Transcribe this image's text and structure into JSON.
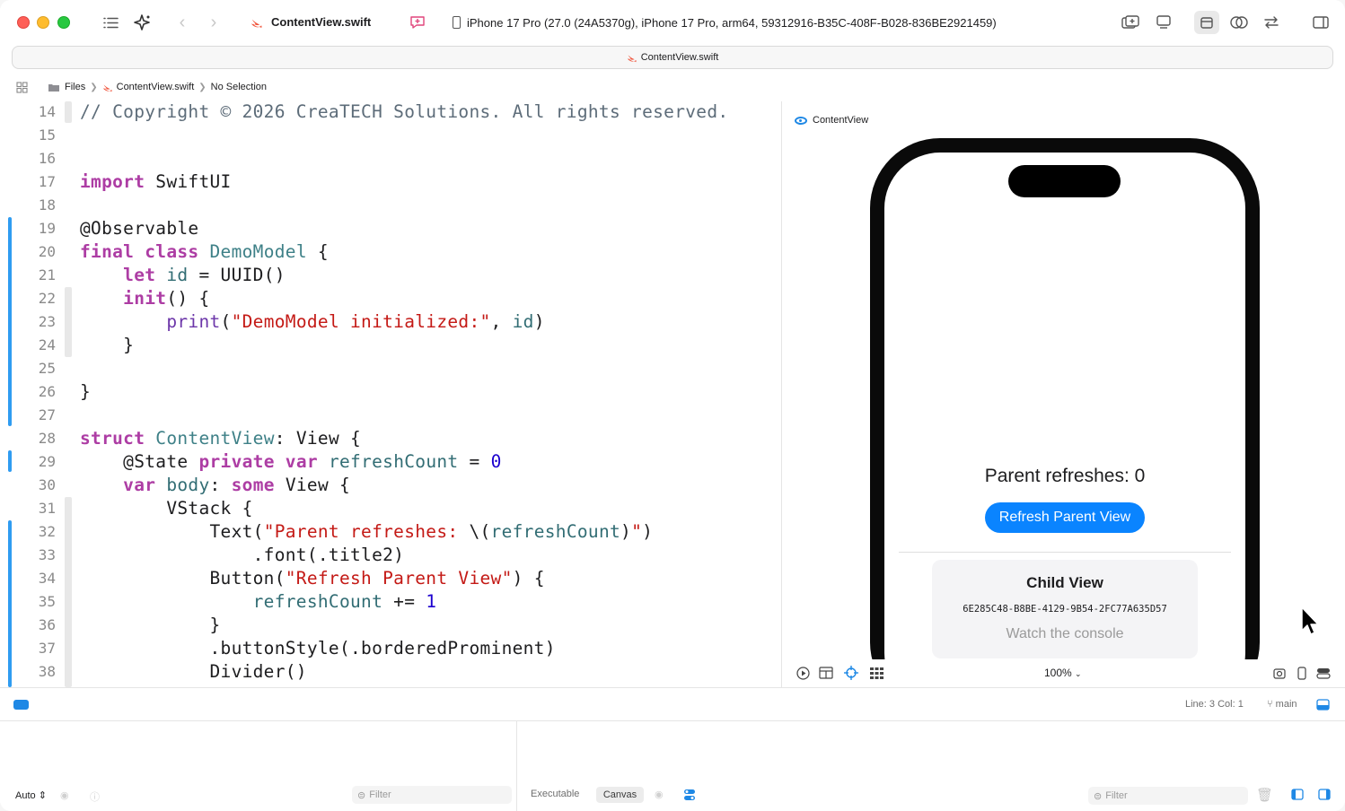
{
  "toolbar": {
    "file_tab": "ContentView.swift",
    "destination": "iPhone 17 Pro (27.0 (24A5370g), iPhone 17 Pro, arm64, 59312916-B35C-408F-B028-836BE2921459)",
    "icons": [
      "sidebar-list-icon",
      "sparkle-icon",
      "back-chevron-icon",
      "forward-chevron-icon",
      "comment-plus-icon",
      "library-icon",
      "device-icon",
      "inspector-icon",
      "review-icon",
      "swap-icon",
      "right-sidebar-icon"
    ]
  },
  "tabbar": {
    "title": "ContentView.swift"
  },
  "jumpbar": {
    "files": "Files",
    "file": "ContentView.swift",
    "selection": "No Selection"
  },
  "editor": {
    "lines": [
      {
        "n": "14"
      },
      {
        "n": "15"
      },
      {
        "n": "16"
      },
      {
        "n": "17"
      },
      {
        "n": "18"
      },
      {
        "n": "19"
      },
      {
        "n": "20"
      },
      {
        "n": "21"
      },
      {
        "n": "22"
      },
      {
        "n": "23"
      },
      {
        "n": "24"
      },
      {
        "n": "25"
      },
      {
        "n": "26"
      },
      {
        "n": "27"
      },
      {
        "n": "28"
      },
      {
        "n": "29"
      },
      {
        "n": "30"
      },
      {
        "n": "31"
      },
      {
        "n": "32"
      },
      {
        "n": "33"
      },
      {
        "n": "34"
      },
      {
        "n": "35"
      },
      {
        "n": "36"
      },
      {
        "n": "37"
      },
      {
        "n": "38"
      }
    ],
    "tokens": {
      "l14": "// Copyright © 2026 CreaTECH Solutions. All rights reserved.",
      "l17_kw": "import",
      "l17_rest": " SwiftUI",
      "l19": "@Observable",
      "l20_kw": "final class",
      "l20_ty": "DemoModel",
      "l20_rest": " {",
      "l21_kw": "let",
      "l21_id": "id",
      "l21_rest": " = UUID()",
      "l22_kw": "init",
      "l22_rest": "() {",
      "l23_fn": "print",
      "l23_p1": "(",
      "l23_str": "\"DemoModel initialized:\"",
      "l23_p2": ", ",
      "l23_id": "id",
      "l23_p3": ")",
      "l24": "}",
      "l26": "}",
      "l28_kw": "struct",
      "l28_ty": "ContentView",
      "l28_rest": ": View {",
      "l29_attr": "@State",
      "l29_kw": "private var",
      "l29_id": "refreshCount",
      "l29_eq": " = ",
      "l29_num": "0",
      "l30_kw": "var",
      "l30_id": "body",
      "l30_p": ": ",
      "l30_kw2": "some",
      "l30_rest": " View {",
      "l31": "VStack {",
      "l32_a": "Text(",
      "l32_str1": "\"Parent refreshes: ",
      "l32_b": "\\(",
      "l32_id": "refreshCount",
      "l32_c": ")",
      "l32_str2": "\"",
      "l32_d": ")",
      "l33": ".font(.title2)",
      "l34_a": "Button(",
      "l34_str": "\"Refresh Parent View\"",
      "l34_b": ") {",
      "l35_id": "refreshCount",
      "l35_op": " += ",
      "l35_num": "1",
      "l36": "}",
      "l37": ".buttonStyle(.borderedProminent)",
      "l38": "Divider()"
    }
  },
  "preview": {
    "label": "ContentView",
    "parent_text": "Parent refreshes: 0",
    "refresh_button": "Refresh Parent View",
    "child_title": "Child View",
    "child_id": "6E285C48-B8BE-4129-9B54-2FC77A635D57",
    "child_hint": "Watch the console",
    "zoom": "100%"
  },
  "statusbar": {
    "line_col": "Line: 3  Col: 1",
    "branch": "main"
  },
  "bottom": {
    "auto": "Auto",
    "filter_left": "Filter",
    "executable": "Executable",
    "canvas": "Canvas",
    "filter_right": "Filter"
  },
  "colors": {
    "keyword": "#ad3da4",
    "type": "#3e8087",
    "string": "#c41a16",
    "number": "#1c00cf",
    "accent": "#0a84ff"
  }
}
